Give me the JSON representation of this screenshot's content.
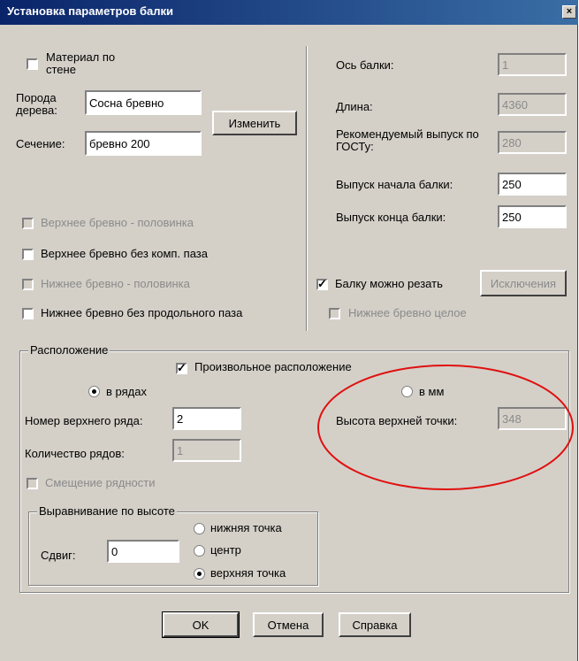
{
  "window": {
    "title": "Установка параметров балки",
    "close": "×"
  },
  "left": {
    "material_label": "Материал по стене",
    "wood_label": "Порода дерева:",
    "wood_value": "Сосна бревно",
    "section_label": "Сечение:",
    "section_value": "бревно 200",
    "change_button": "Изменить",
    "checks": [
      {
        "label": "Верхнее бревно - половинка",
        "checked": false,
        "disabled": true
      },
      {
        "label": "Верхнее бревно без комп. паза",
        "checked": false,
        "disabled": false
      },
      {
        "label": "Нижнее бревно - половинка",
        "checked": false,
        "disabled": true
      },
      {
        "label": "Нижнее бревно без продольного паза",
        "checked": false,
        "disabled": false
      }
    ]
  },
  "right": {
    "axis_label": "Ось балки:",
    "axis_value": "1",
    "length_label": "Длина:",
    "length_value": "4360",
    "gost_label": "Рекомендуемый выпуск по ГОСТу:",
    "gost_value": "280",
    "start_label": "Выпуск начала балки:",
    "start_value": "250",
    "end_label": "Выпуск конца балки:",
    "end_value": "250",
    "cut_label": "Балку можно резать",
    "exceptions_button": "Исключения",
    "whole_label": "Нижнее бревно целое"
  },
  "placement": {
    "legend": "Расположение",
    "arbitrary_label": "Произвольное расположение",
    "in_rows_label": "в рядах",
    "in_mm_label": "в мм",
    "top_row_label": "Номер верхнего ряда:",
    "top_row_value": "2",
    "rows_count_label": "Количество рядов:",
    "rows_count_value": "1",
    "top_height_label": "Высота верхней точки:",
    "top_height_value": "348",
    "offset_rows_label": "Смещение рядности",
    "align": {
      "legend": "Выравнивание по высоте",
      "shift_label": "Сдвиг:",
      "shift_value": "0",
      "bottom": "нижняя точка",
      "center": "центр",
      "top": "верхняя точка"
    }
  },
  "buttons": {
    "ok": "OK",
    "cancel": "Отмена",
    "help": "Справка"
  },
  "annotation_color": "#e01010"
}
